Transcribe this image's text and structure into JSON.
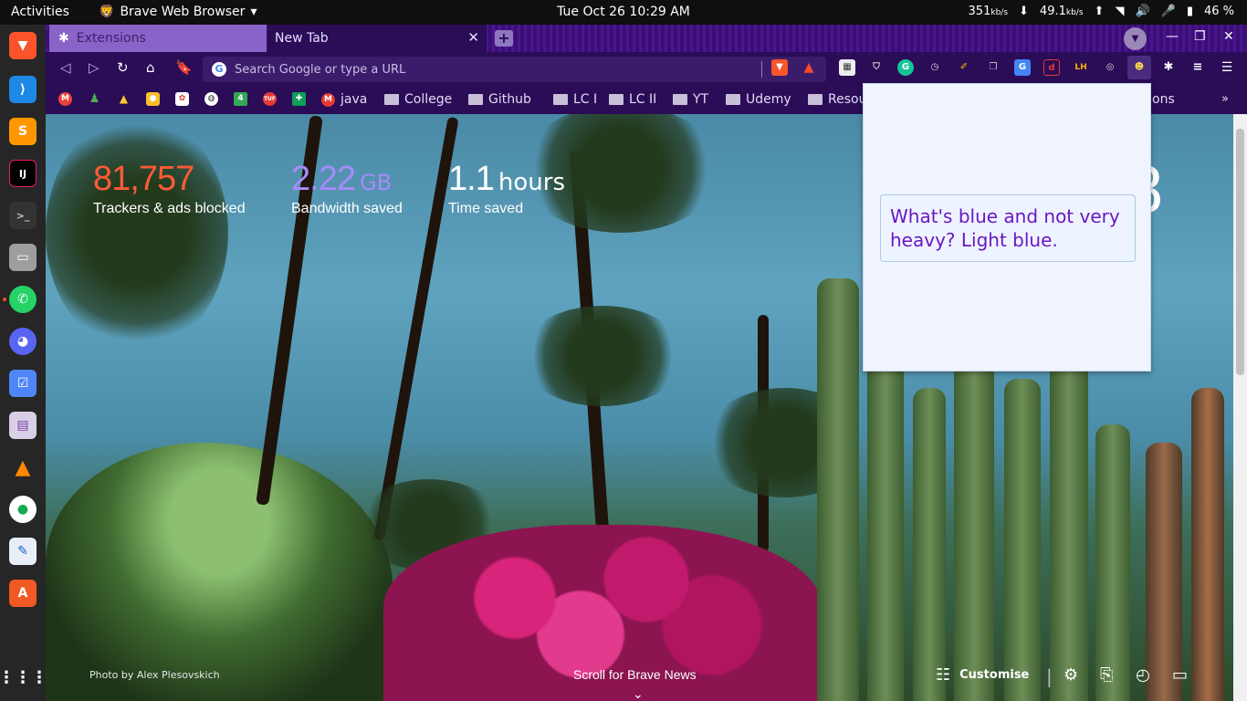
{
  "topbar": {
    "activities": "Activities",
    "app_name": "Brave Web Browser",
    "clock": "Tue Oct 26  10:29 AM",
    "upload_speed": "351",
    "upload_unit": "kb/s",
    "download_speed": "49.1",
    "download_unit": "kb/s",
    "battery": "46 %"
  },
  "tabs": [
    {
      "label": "Extensions"
    },
    {
      "label": "New Tab"
    }
  ],
  "toolbar": {
    "omnibox_placeholder": "Search Google or type a URL"
  },
  "bookmarks": [
    {
      "label": "java",
      "type": "site"
    },
    {
      "label": "College",
      "type": "folder"
    },
    {
      "label": "Github",
      "type": "folder"
    },
    {
      "label": "LC I",
      "type": "folder"
    },
    {
      "label": "LC II",
      "type": "folder"
    },
    {
      "label": "YT",
      "type": "folder"
    },
    {
      "label": "Udemy",
      "type": "folder"
    },
    {
      "label": "Resou",
      "type": "folder"
    },
    {
      "label": "ons",
      "type": "folder"
    }
  ],
  "stats": {
    "trackers_value": "81,757",
    "trackers_label": "Trackers & ads blocked",
    "bandwidth_value": "2.22",
    "bandwidth_unit": "GB",
    "bandwidth_label": "Bandwidth saved",
    "time_value": "1.1",
    "time_unit": "hours",
    "time_label": "Time saved"
  },
  "clock_partial": "8",
  "photo_credit": "Photo by Alex Plesovskich",
  "scroll_news": "Scroll for Brave News",
  "customise_label": "Customise",
  "popup": {
    "joke": "What's blue and not very heavy? Light blue."
  },
  "colors": {
    "trackers": "#ff5a36",
    "bandwidth": "#a78bfa",
    "joke_text": "#6a16c4",
    "browser_theme": "#2a0c57"
  }
}
